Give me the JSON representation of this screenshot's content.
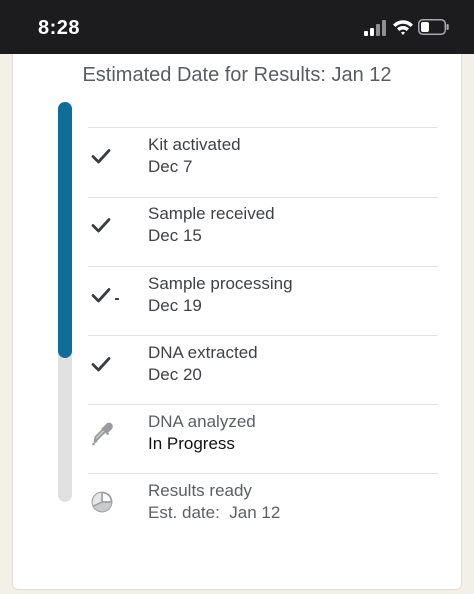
{
  "status_bar": {
    "time": "8:28",
    "icons": [
      "cellular-signal-icon",
      "wifi-icon",
      "battery-icon"
    ]
  },
  "results": {
    "estimated_label": "Estimated Date for Results: Jan 12",
    "progress_fraction": 0.64,
    "accent_color": "#0e6e99",
    "track_color": "#e1e1e1"
  },
  "steps": [
    {
      "title": "Kit activated",
      "subtitle": "Dec 7",
      "state": "done",
      "icon": "checkmark-icon"
    },
    {
      "title": "Sample received",
      "subtitle": "Dec 15",
      "state": "done",
      "icon": "checkmark-icon"
    },
    {
      "title": "Sample processing",
      "subtitle": "Dec 19",
      "state": "done",
      "icon": "checkmark-icon"
    },
    {
      "title": "DNA extracted",
      "subtitle": "Dec 20",
      "state": "done",
      "icon": "checkmark-icon"
    },
    {
      "title": "DNA analyzed",
      "subtitle": "In Progress",
      "state": "in-progress",
      "icon": "pipette-icon"
    },
    {
      "title": "Results ready",
      "subtitle": "Est. date:  Jan 12",
      "state": "pending",
      "icon": "pie-chart-icon"
    }
  ]
}
